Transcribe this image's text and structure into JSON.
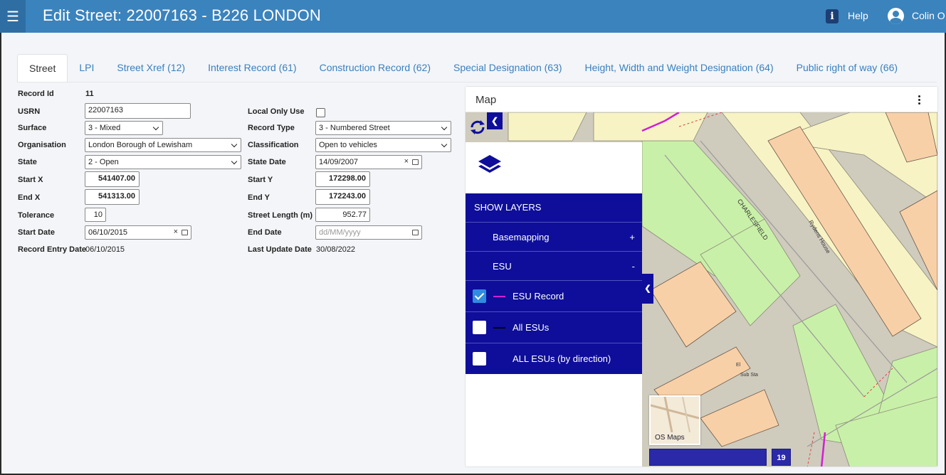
{
  "header": {
    "title": "Edit Street: 22007163 - B226 LONDON",
    "help_label": "Help",
    "user_name": "Colin Or"
  },
  "tabs": [
    {
      "label": "Street",
      "active": true
    },
    {
      "label": "LPI"
    },
    {
      "label": "Street Xref (12)"
    },
    {
      "label": "Interest Record (61)"
    },
    {
      "label": "Construction Record (62)"
    },
    {
      "label": "Special Designation (63)"
    },
    {
      "label": "Height, Width and Weight Designation (64)"
    },
    {
      "label": "Public right of way (66)"
    }
  ],
  "form": {
    "record_id": {
      "label": "Record Id",
      "value": "11"
    },
    "usrn": {
      "label": "USRN",
      "value": "22007163"
    },
    "surface": {
      "label": "Surface",
      "value": "3 - Mixed"
    },
    "organisation": {
      "label": "Organisation",
      "value": "London Borough of Lewisham"
    },
    "state": {
      "label": "State",
      "value": "2 - Open"
    },
    "start_x": {
      "label": "Start X",
      "value": "541407.00"
    },
    "end_x": {
      "label": "End X",
      "value": "541313.00"
    },
    "tolerance": {
      "label": "Tolerance",
      "value": "10"
    },
    "start_date": {
      "label": "Start Date",
      "value": "06/10/2015"
    },
    "record_entry_date": {
      "label": "Record Entry Date",
      "value": "06/10/2015"
    },
    "local_only_use": {
      "label": "Local Only Use",
      "checked": false
    },
    "record_type": {
      "label": "Record Type",
      "value": "3 - Numbered Street"
    },
    "classification": {
      "label": "Classification",
      "value": "Open to vehicles"
    },
    "state_date": {
      "label": "State Date",
      "value": "14/09/2007"
    },
    "start_y": {
      "label": "Start Y",
      "value": "172298.00"
    },
    "end_y": {
      "label": "End Y",
      "value": "172243.00"
    },
    "street_length": {
      "label": "Street Length (m)",
      "value": "952.77"
    },
    "end_date": {
      "label": "End Date",
      "placeholder": "dd/MM/yyyy"
    },
    "last_update_date": {
      "label": "Last Update Date",
      "value": "30/08/2022"
    }
  },
  "map": {
    "title": "Map",
    "layers_panel": {
      "show_layers": "SHOW LAYERS",
      "groups": [
        {
          "label": "Basemapping",
          "toggle": "+"
        },
        {
          "label": "ESU",
          "toggle": "-"
        }
      ],
      "layers": [
        {
          "label": "ESU Record",
          "checked": true,
          "color": "#d21fd2"
        },
        {
          "label": "All ESUs",
          "checked": false,
          "color": "#000000"
        },
        {
          "label": "ALL ESUs (by direction)",
          "checked": false,
          "color": ""
        }
      ]
    },
    "basemap_label": "OS Maps",
    "zoom_level": "19",
    "street_labels": [
      "CHARLESFIELD",
      "Rydens House",
      "Sub Sta",
      "El"
    ],
    "accent": "#0e0e9a"
  }
}
